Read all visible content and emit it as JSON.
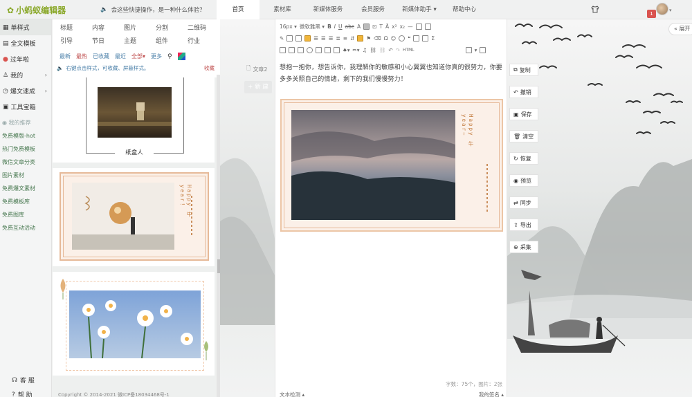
{
  "topbar": {
    "logo": "小蚂蚁编辑器",
    "notice": "会这些快捷操作，是一种什么体验？",
    "tabs": [
      "首页",
      "素材库",
      "新媒体服务",
      "会员服务",
      "新媒体助手",
      "帮助中心"
    ],
    "helper_caret": "▾",
    "badge": "1",
    "avatar_caret": "▾"
  },
  "leftnav": {
    "items": [
      {
        "label": "单样式",
        "icon": "grid-icon",
        "active": true,
        "arrow": ""
      },
      {
        "label": "全文模板",
        "icon": "layout-icon",
        "active": false,
        "arrow": ""
      },
      {
        "label": "过年啦",
        "icon": "lantern-icon",
        "active": false,
        "arrow": ""
      },
      {
        "label": "我的",
        "icon": "user-icon",
        "active": false,
        "arrow": "›"
      },
      {
        "label": "爆文速成",
        "icon": "clock-icon",
        "active": false,
        "arrow": "›"
      },
      {
        "label": "工具宝箱",
        "icon": "toolbox-icon",
        "active": false,
        "arrow": ""
      }
    ],
    "links": [
      {
        "label": "我的推荐",
        "grey": true
      },
      {
        "label": "免费模版-hot",
        "grey": false
      },
      {
        "label": "热门免费模板",
        "grey": false
      },
      {
        "label": "微信文章分类",
        "grey": false
      },
      {
        "label": "图片素材",
        "grey": false
      },
      {
        "label": "免费爆文素材",
        "grey": false
      },
      {
        "label": "免费模板库",
        "grey": false
      },
      {
        "label": "免费图库",
        "grey": false
      },
      {
        "label": "免费互动活动",
        "grey": false
      }
    ],
    "service": "客 服",
    "help": "帮 助"
  },
  "panel": {
    "categories": [
      "标题",
      "内容",
      "图片",
      "分割",
      "二维码",
      "引导",
      "节日",
      "主题",
      "组件",
      "行业"
    ],
    "filters": [
      "最新",
      "最热",
      "已收藏",
      "最近",
      "全部"
    ],
    "all_caret": "▾",
    "more": "更多",
    "tip": "右键点击样式，可收藏、屏蔽样式。",
    "collect": "收藏",
    "caption1": "纸盒人",
    "card_vertical_text": "Happy 牛 year!"
  },
  "editor": {
    "doc_label": "文章2",
    "new_button": "新 建",
    "font_size": "16px",
    "font_family": "微软雅黑",
    "body_text": "想抱一抱你，想告诉你，我理解你的敏感和小心翼翼也知道你真的很努力，你要多多关照自己的情绪，剩下的我们慢慢努力！",
    "image_vertical_text": "Happy 牛 year~",
    "stats": "字数：75个，图片：2张",
    "footer_left": "文本检测",
    "footer_right": "我的签名"
  },
  "actions": [
    "复制",
    "撤销",
    "保存",
    "清空",
    "恢复",
    "预览",
    "同步",
    "导出",
    "采集"
  ],
  "expand": "« 展开",
  "copyright": "Copyright © 2014-2021 微ICP备18034468号-1"
}
